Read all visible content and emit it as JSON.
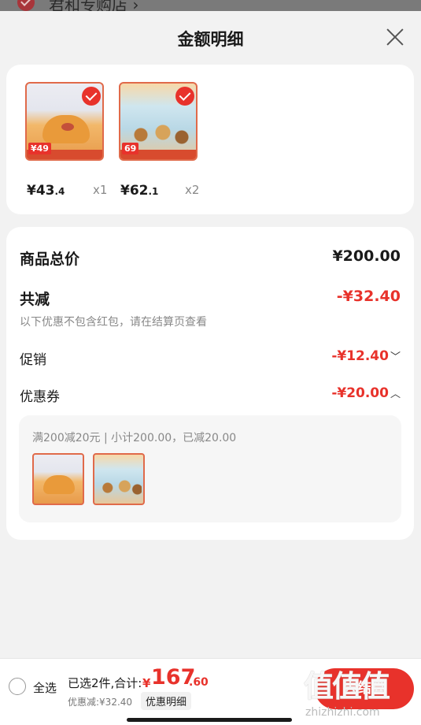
{
  "backdrop": {
    "store_name": "君和专购店 ›"
  },
  "sheet": {
    "title": "金额明细"
  },
  "products": [
    {
      "badge": "¥49",
      "price_int": "¥43",
      "price_dec": ".4",
      "qty": "x1"
    },
    {
      "badge": "69",
      "price_int": "¥62",
      "price_dec": ".1",
      "qty": "x2"
    }
  ],
  "summary": {
    "total_label": "商品总价",
    "total_value": "¥200.00",
    "reduction_label": "共减",
    "reduction_value": "-¥32.40",
    "note": "以下优惠不包含红包，请在结算页查看",
    "promo_label": "促销",
    "promo_value": "-¥12.40",
    "coupon_label": "优惠券",
    "coupon_value": "-¥20.00",
    "coupon_desc": "满200减20元 | 小计200.00，已减20.00"
  },
  "bottom": {
    "select_all": "全选",
    "selected": "已选2件,合计:",
    "yen": "¥",
    "total_int": "167",
    "total_dec": ".60",
    "discount": "优惠减:¥32.40",
    "detail_button": "优惠明细",
    "checkout": "去结算",
    "watermark_logo": "值值值",
    "watermark_site": "zhizhizhi.com"
  },
  "colors": {
    "accent": "#e8322b",
    "text": "#1a1a1a",
    "muted": "#888888"
  }
}
